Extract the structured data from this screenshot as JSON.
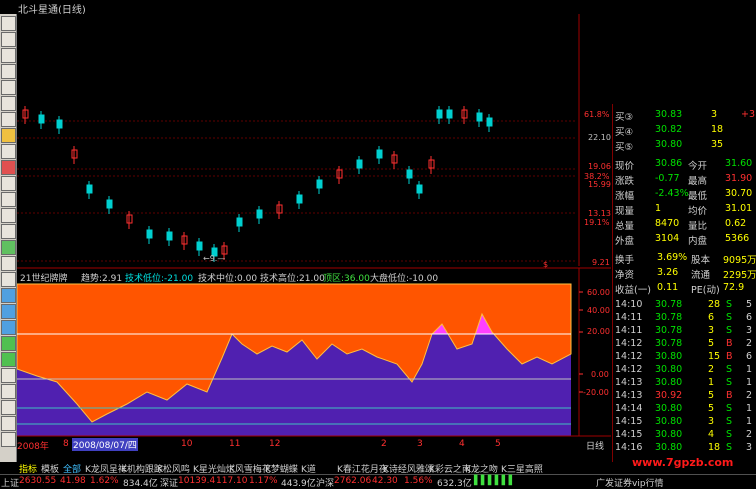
{
  "window": {
    "title": "北斗星通(日线)"
  },
  "price_axis": [
    "61.8%",
    "22.10",
    "19.06",
    "38.2%",
    "15.99",
    "13.13",
    "19.1%",
    "9.21"
  ],
  "price_axis_labels": {
    "low_marker": "←9.—",
    "dollar": "$"
  },
  "indicator": {
    "name": "21世纪牌牌",
    "trend": "趋势:2.91",
    "tech_low": "技术低位:-21.00",
    "tech_mid": "技术中位:0.00",
    "tech_high": "技术高位:21.00",
    "top_zone": "顶区:36.00",
    "market_low": "大盘低位:-10.00"
  },
  "indicator_axis": [
    "60.00",
    "40.00",
    "20.00",
    "0.00",
    "-20.00"
  ],
  "date_bar": {
    "year": "2008年",
    "num": "8",
    "cursor_date": "2008/08/07/四",
    "months": [
      "10",
      "11",
      "12",
      "2",
      "3",
      "4",
      "5"
    ],
    "period": "日线"
  },
  "quote_panel": {
    "orders": [
      {
        "label": "买③",
        "price": "30.83",
        "vol": "3",
        "extra": "+3"
      },
      {
        "label": "买④",
        "price": "30.82",
        "vol": "18",
        "extra": ""
      },
      {
        "label": "买⑤",
        "price": "30.80",
        "vol": "35",
        "extra": ""
      }
    ],
    "stats": [
      {
        "l1": "现价",
        "v1": "30.86",
        "l2": "今开",
        "v2": "31.60"
      },
      {
        "l1": "涨跌",
        "v1": "-0.77",
        "l2": "最高",
        "v2": "31.90"
      },
      {
        "l1": "涨幅",
        "v1": "-2.43%",
        "l2": "最低",
        "v2": "30.70"
      },
      {
        "l1": "现量",
        "v1": "1",
        "l2": "均价",
        "v2": "31.01"
      },
      {
        "l1": "总量",
        "v1": "8470",
        "l2": "量比",
        "v2": "0.62"
      },
      {
        "l1": "外盘",
        "v1": "3104",
        "l2": "内盘",
        "v2": "5366"
      }
    ],
    "stats2": [
      {
        "l1": "换手",
        "v1": "3.69%",
        "l2": "股本",
        "v2": "9095万"
      },
      {
        "l1": "净资",
        "v1": "3.26",
        "l2": "流通",
        "v2": "2295万"
      },
      {
        "l1": "收益(一)",
        "v1": "0.11",
        "l2": "PE(动)",
        "v2": "72.9"
      }
    ],
    "trades": [
      {
        "time": "14:10",
        "price": "30.78",
        "vol": "28",
        "side": "S",
        "n": "5"
      },
      {
        "time": "14:11",
        "price": "30.78",
        "vol": "6",
        "side": "S",
        "n": "6"
      },
      {
        "time": "14:11",
        "price": "30.78",
        "vol": "3",
        "side": "S",
        "n": "3"
      },
      {
        "time": "14:12",
        "price": "30.78",
        "vol": "5",
        "side": "B",
        "n": "2"
      },
      {
        "time": "14:12",
        "price": "30.80",
        "vol": "15",
        "side": "B",
        "n": "6"
      },
      {
        "time": "14:12",
        "price": "30.80",
        "vol": "2",
        "side": "S",
        "n": "1"
      },
      {
        "time": "14:13",
        "price": "30.80",
        "vol": "1",
        "side": "S",
        "n": "1"
      },
      {
        "time": "14:13",
        "price": "30.92",
        "vol": "5",
        "side": "B",
        "n": "2"
      },
      {
        "time": "14:14",
        "price": "30.80",
        "vol": "5",
        "side": "S",
        "n": "1"
      },
      {
        "time": "14:15",
        "price": "30.80",
        "vol": "3",
        "side": "S",
        "n": "1"
      },
      {
        "time": "14:15",
        "price": "30.80",
        "vol": "4",
        "side": "S",
        "n": "2"
      },
      {
        "time": "14:16",
        "price": "30.80",
        "vol": "18",
        "side": "S",
        "n": "3"
      },
      {
        "time": "14:16",
        "price": "30.80",
        "vol": "1",
        "side": "S",
        "n": "1"
      }
    ]
  },
  "tabs": [
    "指标",
    "模板",
    "全部",
    "K龙凤呈祥",
    "K机构跟踪",
    "K松风鸣",
    "K星光灿烂",
    "K风雪梅花",
    "K梦蝴蝶",
    "K道",
    "K春江花月夜",
    "K诗经风雅颂",
    "K彩云之南",
    "K龙之吻",
    "K三星高照"
  ],
  "status": {
    "sh_label": "上证",
    "sh_index": "2630.55",
    "sh_change": "41.98",
    "sh_pct": "1.62%",
    "sh_amount": "834.4亿",
    "sz_label": "深证",
    "sz_index": "10139.4",
    "sz_change": "117.10",
    "sz_pct": "1.17%",
    "sz_amount": "443.9亿",
    "hs_label": "沪深",
    "hs_index": "2762.06",
    "hs_change": "42.30",
    "hs_pct": "1.56%",
    "hs_amount": "632.3亿",
    "broker": "广发证券vip行情"
  },
  "watermark": "www.7gpzb.com",
  "colors": {
    "up": "#ff3030",
    "down": "#00d0d0",
    "indicator_top": "#ff5500",
    "indicator_pink": "#ff40ff",
    "indicator_fill": "#5020b0"
  }
}
